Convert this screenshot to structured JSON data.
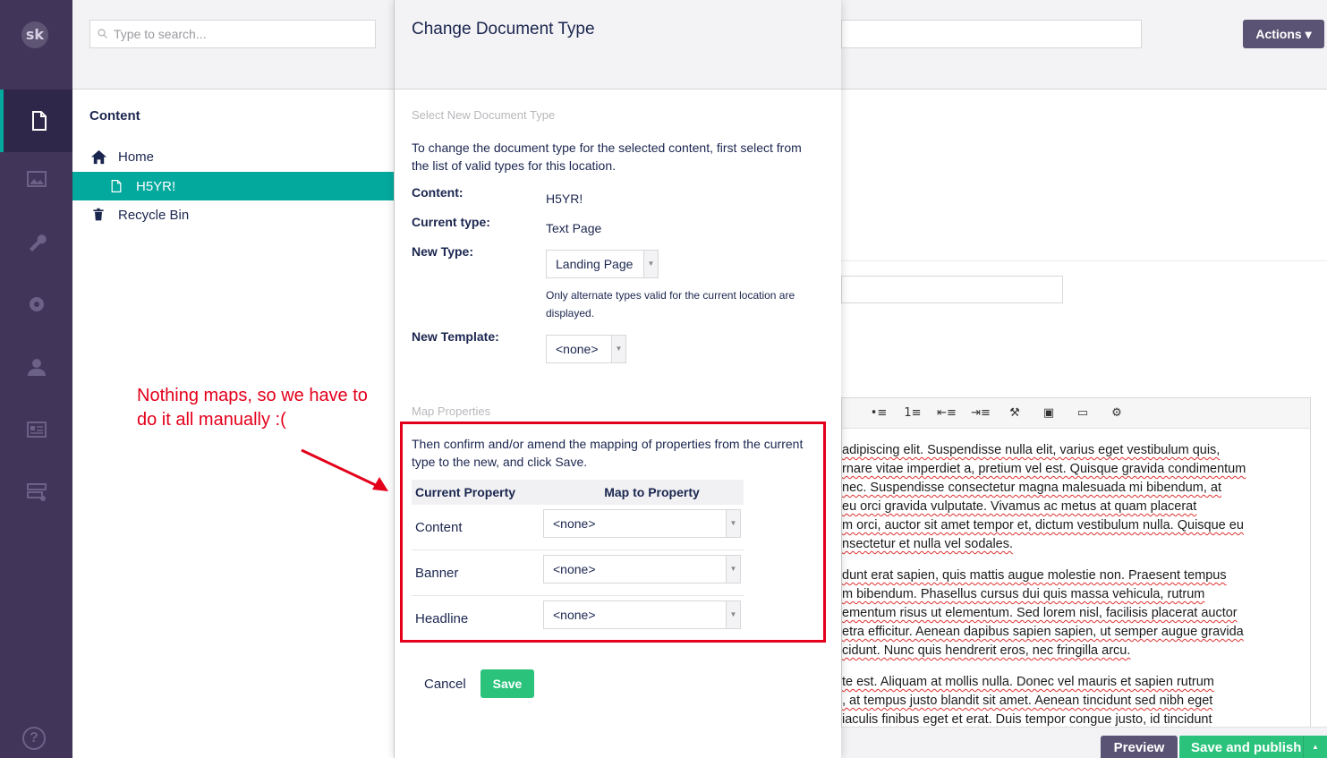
{
  "rail": {
    "logo_text": "sk",
    "sections": [
      "content-icon",
      "media-icon",
      "wrench-icon",
      "gear-icon",
      "person-icon",
      "member-card-icon",
      "forms-icon"
    ],
    "help": "?"
  },
  "tree": {
    "search_placeholder": "Type to search...",
    "root_label": "Content",
    "nodes": [
      {
        "label": "Home",
        "icon": "home-icon"
      },
      {
        "label": "H5YR!",
        "icon": "document-icon"
      },
      {
        "label": "Recycle Bin",
        "icon": "trash-icon"
      }
    ]
  },
  "editor": {
    "actions_label": "Actions",
    "toolbar": [
      "•≡",
      "1≡",
      "⇤≡",
      "⇥≡",
      "⚒",
      "▣",
      "▭",
      "⚙"
    ],
    "paragraphs": [
      [
        "adipiscing elit. Suspendisse nulla elit, varius eget vestibulum quis,",
        "rnare vitae imperdiet a, pretium vel est. Quisque gravida condimentum",
        "nec. Suspendisse consectetur magna malesuada mi bibendum, at",
        "eu orci gravida vulputate. Vivamus ac metus at quam placerat",
        "m orci, auctor sit amet tempor et, dictum vestibulum nulla. Quisque eu",
        "nsectetur et nulla vel sodales."
      ],
      [
        "dunt erat sapien, quis mattis augue molestie non. Praesent tempus",
        "m bibendum. Phasellus cursus dui quis massa vehicula, rutrum",
        "ementum risus ut elementum. Sed lorem nisl, facilisis placerat auctor",
        "etra efficitur. Aenean dapibus sapien sapien, ut semper augue gravida",
        "cidunt. Nunc quis hendrerit eros, nec fringilla arcu."
      ],
      [
        "te est. Aliquam at mollis nulla. Donec vel mauris et sapien rutrum",
        ", at tempus justo blandit sit amet. Aenean tincidunt sed nibh eget",
        "iaculis finibus eget et erat. Duis tempor congue justo, id tincidunt"
      ]
    ],
    "preview_label": "Preview",
    "publish_label": "Save and publish"
  },
  "dialog": {
    "title": "Change Document Type",
    "select_heading": "Select New Document Type",
    "intro": "To change the document type for the selected content, first select from the list of valid types for this location.",
    "content_label": "Content:",
    "content_value": "H5YR!",
    "current_type_label": "Current type:",
    "current_type_value": "Text Page",
    "new_type_label": "New Type:",
    "new_type_value": "Landing Page",
    "new_type_hint": "Only alternate types valid for the current location are displayed.",
    "new_template_label": "New Template:",
    "new_template_value": "<none>",
    "map_heading": "Map Properties",
    "map_intro": "Then confirm and/or amend the mapping of properties from the current type to the new, and click Save.",
    "table": {
      "headers": [
        "Current Property",
        "Map to Property"
      ],
      "rows": [
        {
          "property": "Content",
          "mapped": "<none>"
        },
        {
          "property": "Banner",
          "mapped": "<none>"
        },
        {
          "property": "Headline",
          "mapped": "<none>"
        }
      ]
    },
    "cancel_label": "Cancel",
    "save_label": "Save"
  },
  "annotation": {
    "text": "Nothing maps, so we have to do it all manually :(",
    "color": "#e3001b"
  },
  "colors": {
    "rail": "#413659",
    "accent": "#04a99e",
    "green": "#2bc37c",
    "actions": "#5a5373"
  }
}
